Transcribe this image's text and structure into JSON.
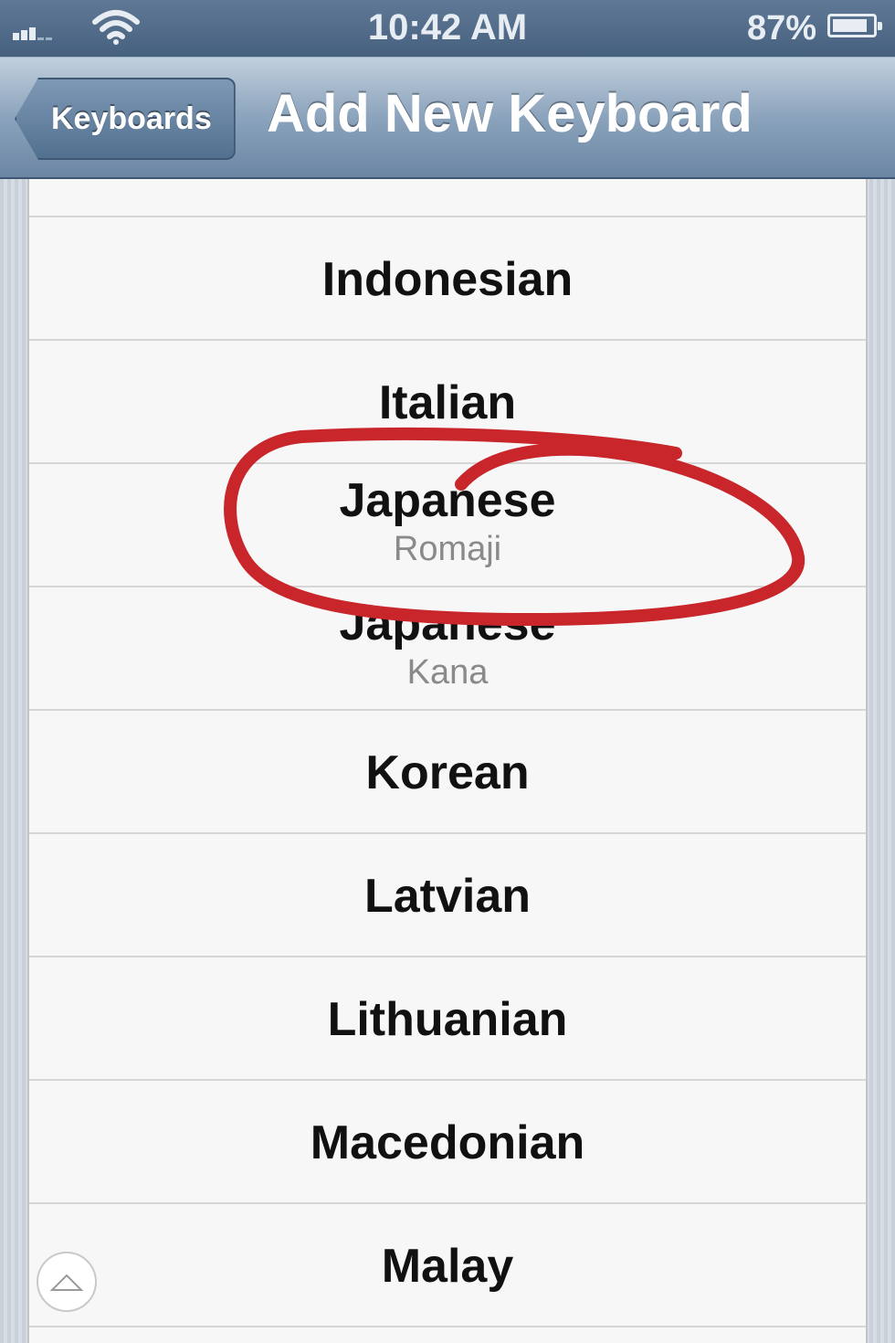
{
  "status_bar": {
    "time": "10:42 AM",
    "battery_percent": "87%",
    "battery_level": 0.87,
    "signal_icon": "cellular-signal-icon",
    "wifi_icon": "wifi-icon"
  },
  "nav": {
    "back_label": "Keyboards",
    "title": "Add New Keyboard"
  },
  "keyboards": [
    {
      "label": "Indonesian",
      "sub": ""
    },
    {
      "label": "Italian",
      "sub": ""
    },
    {
      "label": "Japanese",
      "sub": "Romaji"
    },
    {
      "label": "Japanese",
      "sub": "Kana"
    },
    {
      "label": "Korean",
      "sub": ""
    },
    {
      "label": "Latvian",
      "sub": ""
    },
    {
      "label": "Lithuanian",
      "sub": ""
    },
    {
      "label": "Macedonian",
      "sub": ""
    },
    {
      "label": "Malay",
      "sub": ""
    }
  ],
  "annotation": {
    "color": "#c8262b",
    "target": "Japanese Romaji"
  },
  "colors": {
    "navbar": "#6b86a4",
    "statusbar": "#4f6a88",
    "row_background": "#f7f7f7"
  }
}
